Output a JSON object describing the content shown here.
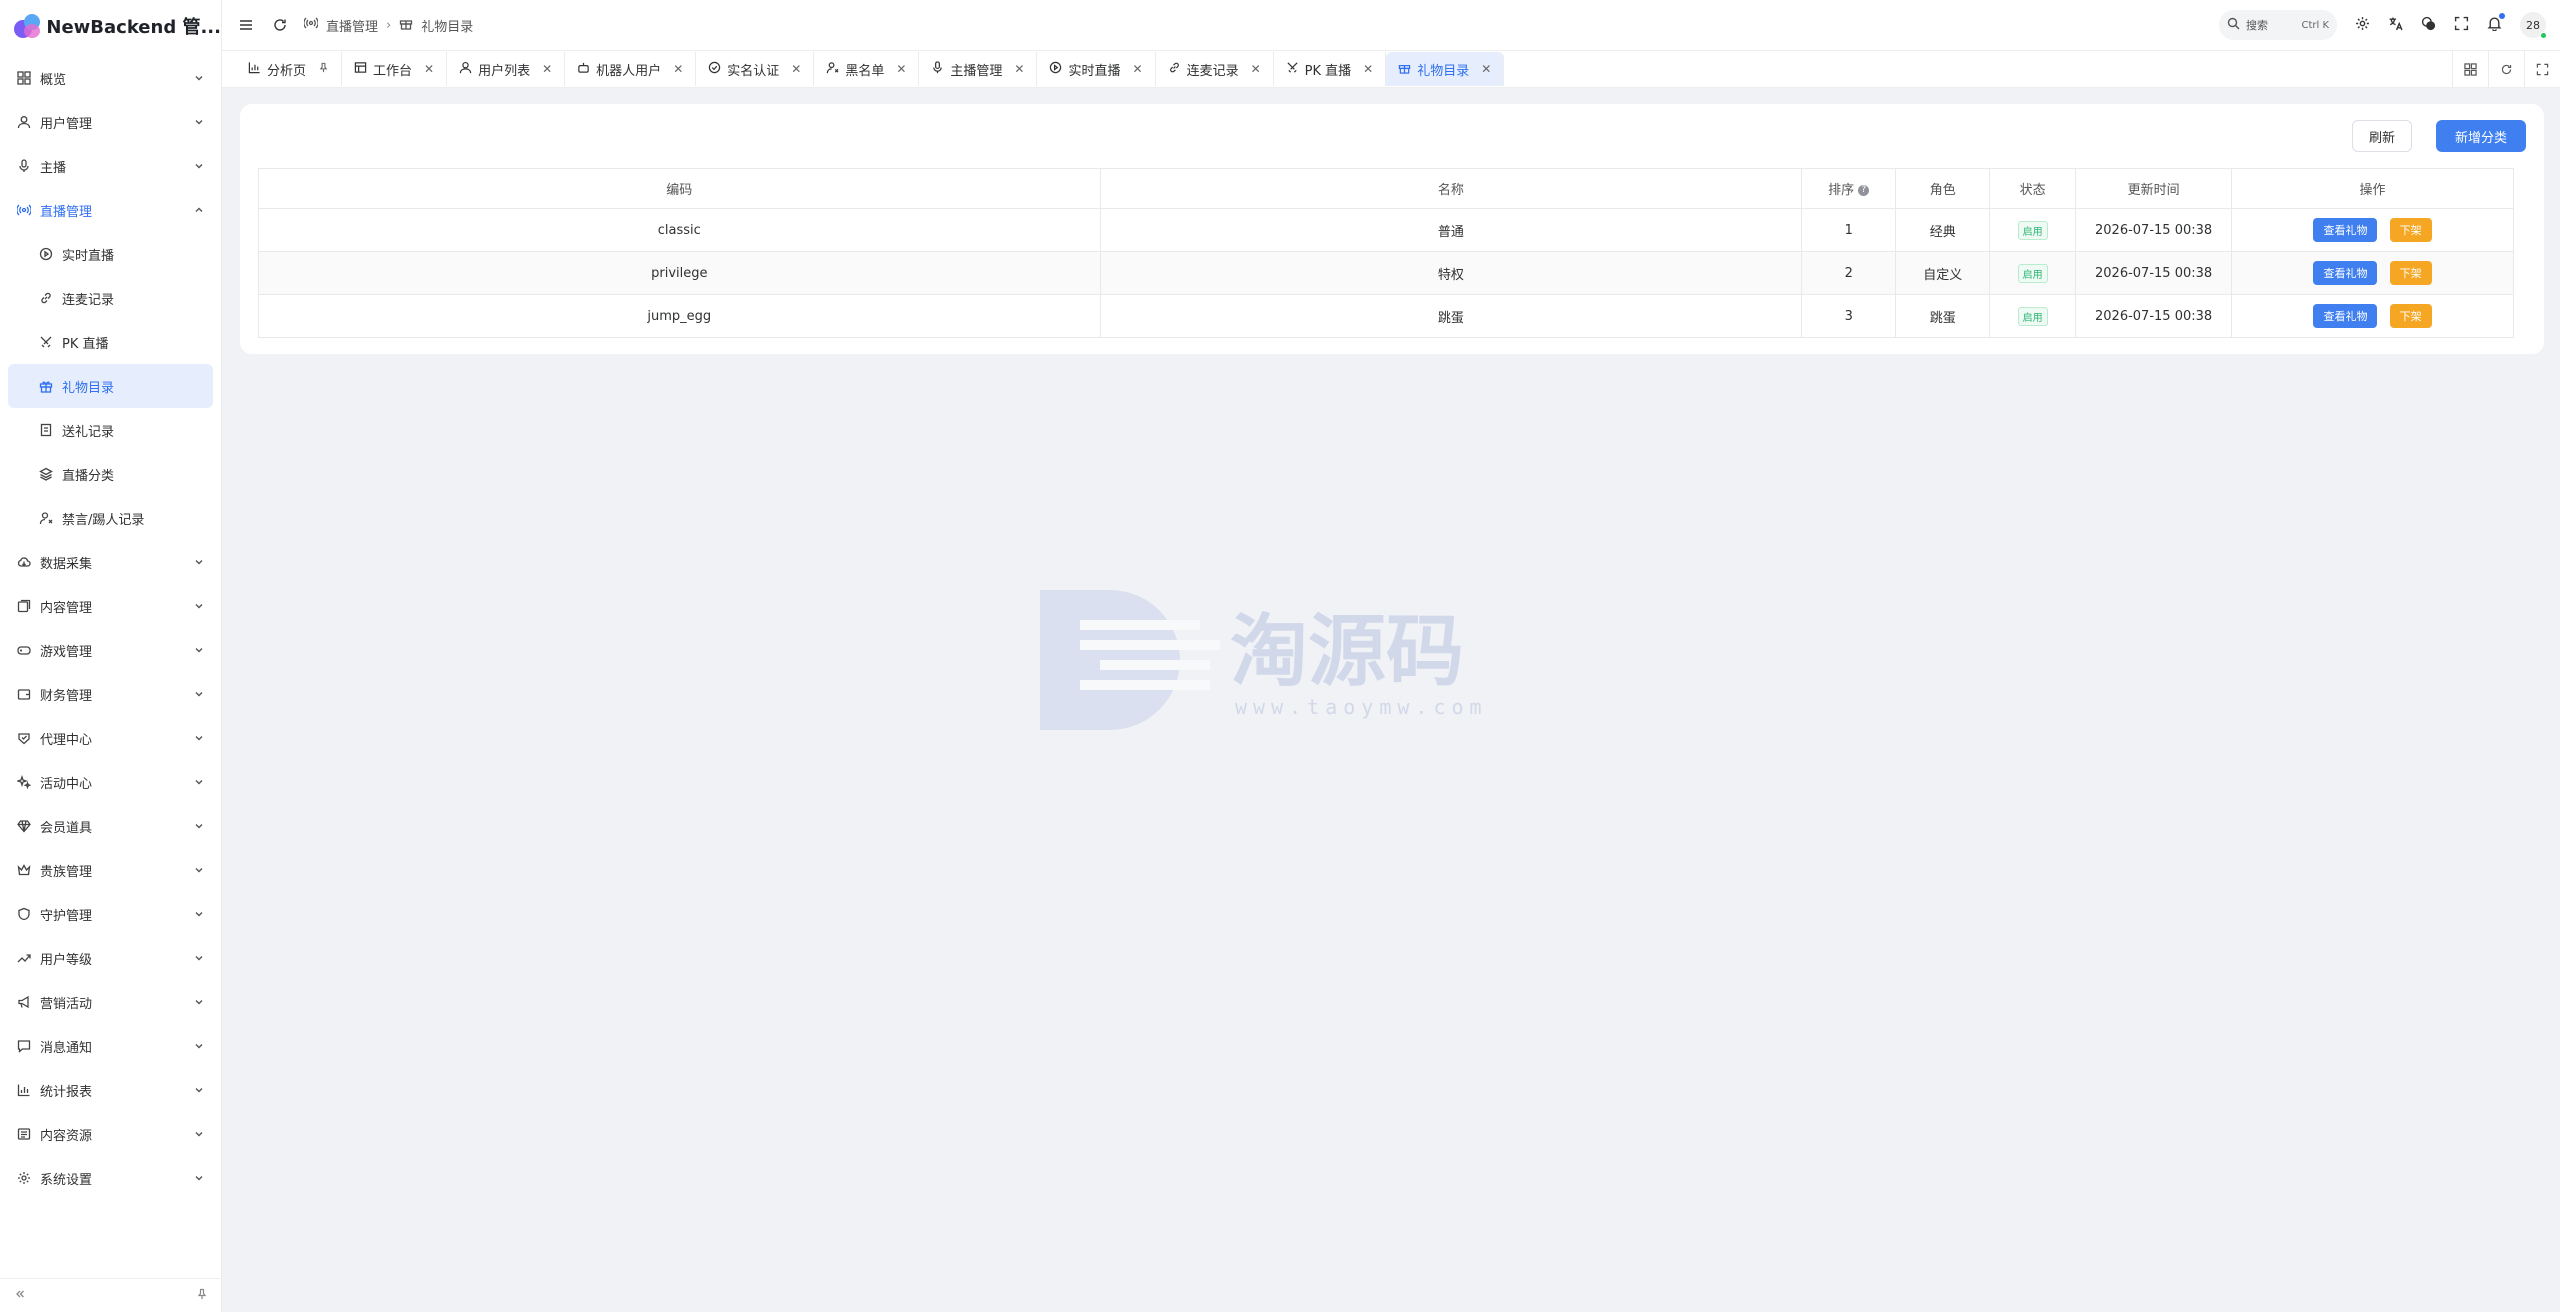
{
  "brand": {
    "title": "NewBackend 管..."
  },
  "sidebar": {
    "items": [
      {
        "label": "概览",
        "icon": "grid-icon"
      },
      {
        "label": "用户管理",
        "icon": "user-icon"
      },
      {
        "label": "主播",
        "icon": "mic-icon"
      },
      {
        "label": "直播管理",
        "icon": "broadcast-icon"
      },
      {
        "label": "数据采集",
        "icon": "cloud-icon"
      },
      {
        "label": "内容管理",
        "icon": "content-icon"
      },
      {
        "label": "游戏管理",
        "icon": "gamepad-icon"
      },
      {
        "label": "财务管理",
        "icon": "wallet-icon"
      },
      {
        "label": "代理中心",
        "icon": "agent-icon"
      },
      {
        "label": "活动中心",
        "icon": "sparkle-icon"
      },
      {
        "label": "会员道具",
        "icon": "diamond-icon"
      },
      {
        "label": "贵族管理",
        "icon": "crown-icon"
      },
      {
        "label": "守护管理",
        "icon": "shield-icon"
      },
      {
        "label": "用户等级",
        "icon": "trend-icon"
      },
      {
        "label": "营销活动",
        "icon": "megaphone-icon"
      },
      {
        "label": "消息通知",
        "icon": "message-icon"
      },
      {
        "label": "统计报表",
        "icon": "chart-icon"
      },
      {
        "label": "内容资源",
        "icon": "folder-icon"
      },
      {
        "label": "系统设置",
        "icon": "gear-icon"
      }
    ],
    "live_sub": [
      {
        "label": "实时直播",
        "icon": "play-circle-icon"
      },
      {
        "label": "连麦记录",
        "icon": "link-icon"
      },
      {
        "label": "PK 直播",
        "icon": "swords-icon"
      },
      {
        "label": "礼物目录",
        "icon": "gift-icon"
      },
      {
        "label": "送礼记录",
        "icon": "receipt-icon"
      },
      {
        "label": "直播分类",
        "icon": "layers-icon"
      },
      {
        "label": "禁言/踢人记录",
        "icon": "user-ban-icon"
      }
    ]
  },
  "header": {
    "breadcrumb": [
      "直播管理",
      "礼物目录"
    ],
    "search_label": "搜索",
    "search_kbd": "Ctrl K",
    "avatar_text": "28"
  },
  "tabs": [
    {
      "label": "分析页",
      "icon": "chart-icon",
      "pinned": true
    },
    {
      "label": "工作台",
      "icon": "workspace-icon"
    },
    {
      "label": "用户列表",
      "icon": "user-icon"
    },
    {
      "label": "机器人用户",
      "icon": "robot-icon"
    },
    {
      "label": "实名认证",
      "icon": "id-icon"
    },
    {
      "label": "黑名单",
      "icon": "user-ban-icon"
    },
    {
      "label": "主播管理",
      "icon": "mic-icon"
    },
    {
      "label": "实时直播",
      "icon": "play-circle-icon"
    },
    {
      "label": "连麦记录",
      "icon": "link-icon"
    },
    {
      "label": "PK 直播",
      "icon": "swords-icon"
    },
    {
      "label": "礼物目录",
      "icon": "gift-icon",
      "active": true
    }
  ],
  "toolbar": {
    "refresh_label": "刷新",
    "add_label": "新增分类"
  },
  "table": {
    "headers": [
      "编码",
      "名称",
      "排序",
      "角色",
      "状态",
      "更新时间",
      "操作"
    ],
    "rows": [
      {
        "code": "classic",
        "name": "普通",
        "sort": "1",
        "role": "经典",
        "status": "启用",
        "updated": "2026-07-15 00:38",
        "view": "查看礼物",
        "off": "下架"
      },
      {
        "code": "privilege",
        "name": "特权",
        "sort": "2",
        "role": "自定义",
        "status": "启用",
        "updated": "2026-07-15 00:38",
        "view": "查看礼物",
        "off": "下架"
      },
      {
        "code": "jump_egg",
        "name": "跳蛋",
        "sort": "3",
        "role": "跳蛋",
        "status": "启用",
        "updated": "2026-07-15 00:38",
        "view": "查看礼物",
        "off": "下架"
      }
    ]
  },
  "watermark": {
    "title": "淘源码",
    "url": "www.taoymw.com"
  },
  "colors": {
    "accent": "#3f7ff0",
    "warning": "#f5a623",
    "success": "#2bb673"
  }
}
